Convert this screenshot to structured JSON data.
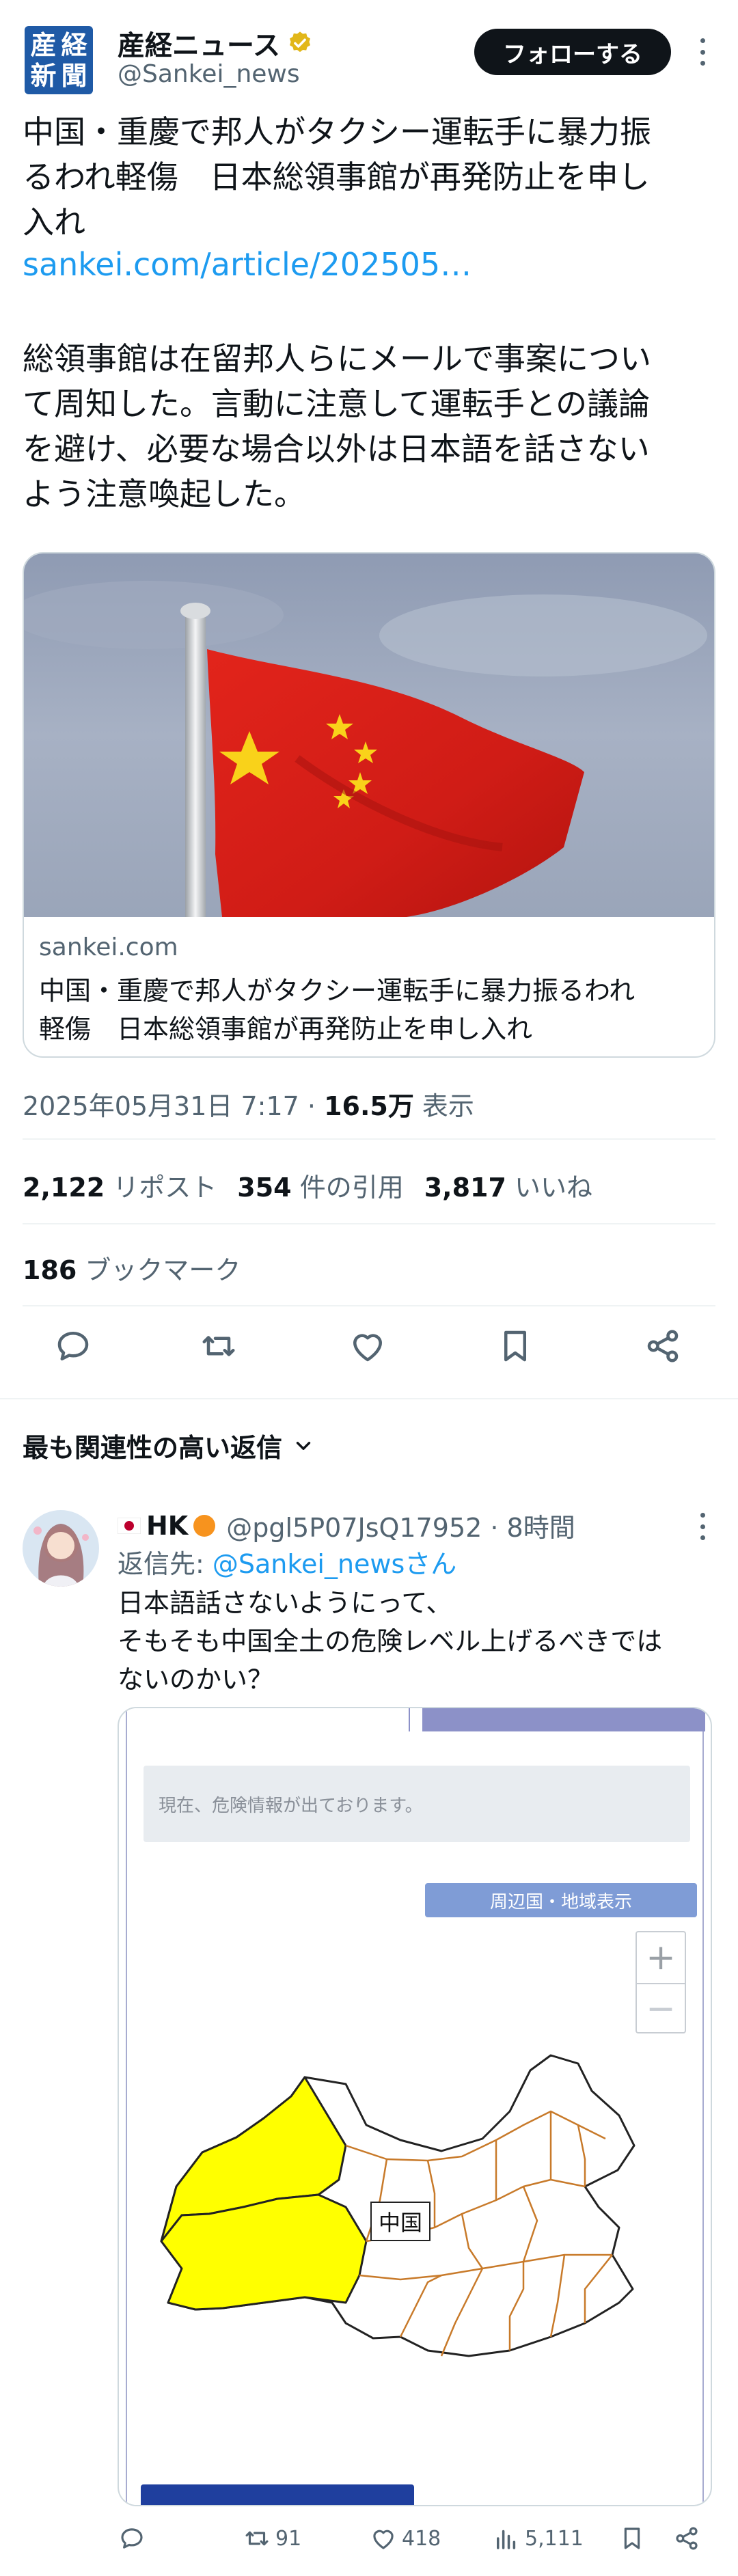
{
  "account": {
    "display_name": "産経ニュース",
    "handle": "@Sankei_news",
    "logo_chars": [
      "産",
      "経",
      "新",
      "聞"
    ],
    "follow_label": "フォローする"
  },
  "tweet": {
    "headline": "中国・重慶で邦人がタクシー運転手に暴力振\nるわれ軽傷　日本総領事館が再発防止を申し\n入れ",
    "link": "sankei.com/article/202505…",
    "body": "総領事館は在留邦人らにメールで事案につい\nて周知した。言動に注意して運転手との議論\nを避け、必要な場合以外は日本語を話さない\nよう注意喚起した。",
    "card_domain": "sankei.com",
    "card_title": "中国・重慶で邦人がタクシー運転手に暴力振るわれ\n軽傷　日本総領事館が再発防止を申し入れ",
    "timestamp": "2025年05月31日 7:17 · ",
    "views_count": "16.5万",
    "views_label": " 表示",
    "reposts_count": "2,122",
    "reposts_label": " リポスト",
    "quotes_count": "354",
    "quotes_label": " 件の引用",
    "likes_count": "3,817",
    "likes_label": " いいね",
    "bookmarks_count": "186",
    "bookmarks_label": " ブックマーク"
  },
  "replies_sort_label": "最も関連性の高い返信",
  "reply": {
    "name": "HK",
    "handle": "@pgl5P07JsQ17952 · 8時間",
    "reply_to_prefix": "返信先: ",
    "reply_to_handle": "@Sankei_newsさん",
    "text": "日本語話さないようにって、\nそもそも中国全土の危険レベル上げるべきでは\nないのかい？",
    "image": {
      "info_text": "現在、危険情報が出ております。",
      "region_button": "周辺国・地域表示",
      "zoom_in": "+",
      "zoom_out": "−",
      "country_label": "中国"
    },
    "actions": {
      "reposts": "91",
      "likes": "418",
      "views": "5,111"
    }
  },
  "colors": {
    "accent": "#1d9bf0",
    "text": "#0f1419",
    "muted": "#536471",
    "hazard_yellow": "#ffff00",
    "province_border": "#c87a2a"
  }
}
